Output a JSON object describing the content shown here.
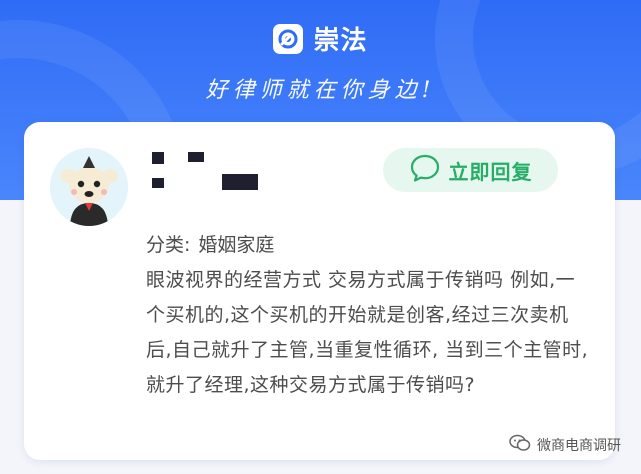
{
  "header": {
    "brand_name": "崇法",
    "slogan": "好律师就在你身边!",
    "logo_icon": "brand-logo-icon"
  },
  "card": {
    "author_name_redacted": true,
    "reply_button": {
      "label": "立即回复",
      "icon": "chat-bubble-icon"
    },
    "category": {
      "label": "分类:",
      "value": "婚姻家庭"
    },
    "question": "眼波视界的经营方式 交易方式属于传销吗 例如,一个买机的,这个买机的开始就是创客,经过三次卖机后,自己就升了主管,当重复性循环, 当到三个主管时,就升了经理,这种交易方式属于传销吗?"
  },
  "watermark": {
    "text": "微商电商调研",
    "icon": "wechat-icon"
  },
  "colors": {
    "hero": "#2f6cf6",
    "accent_green": "#27ae66",
    "button_bg": "#e5f7ee",
    "text": "#4d4d4d"
  }
}
